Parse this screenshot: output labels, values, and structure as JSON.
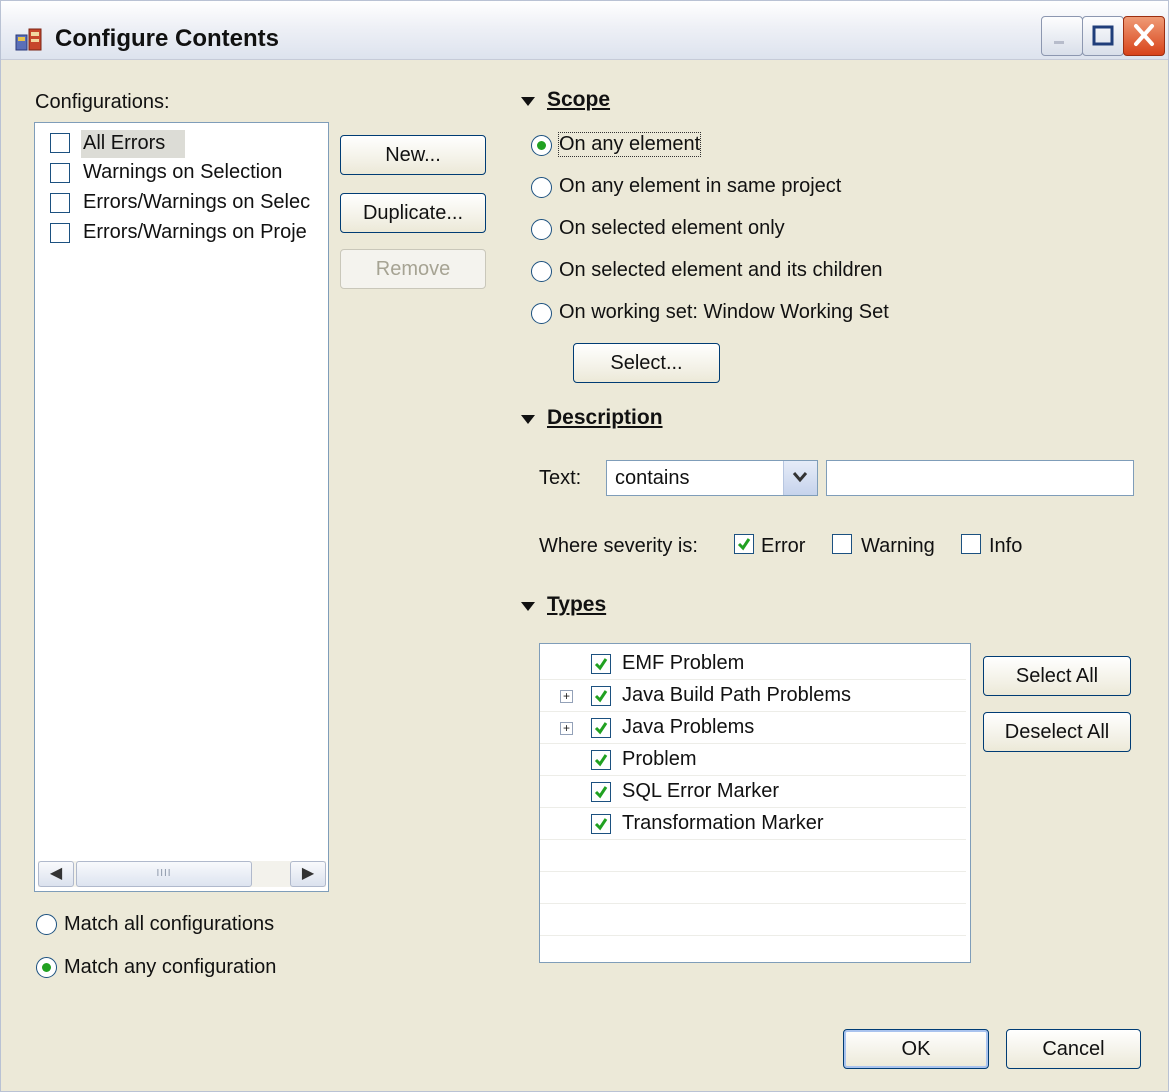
{
  "window": {
    "title": "Configure Contents",
    "accent": "#0a246a",
    "check_color": "#21a121",
    "close_color": "#d8431a"
  },
  "configurations": {
    "label": "Configurations:",
    "items": [
      {
        "label": "All Errors",
        "checked": false,
        "selected": true
      },
      {
        "label": "Warnings on Selection",
        "checked": false
      },
      {
        "label": "Errors/Warnings on Selec",
        "checked": false
      },
      {
        "label": "Errors/Warnings on Proje",
        "checked": false
      }
    ],
    "scroll_thumb_glyph": "IIII"
  },
  "buttons": {
    "new": "New...",
    "duplicate": "Duplicate...",
    "remove": "Remove",
    "select": "Select...",
    "select_all": "Select All",
    "deselect_all": "Deselect All",
    "ok": "OK",
    "cancel": "Cancel"
  },
  "match": {
    "all": "Match all configurations",
    "any": "Match any configuration",
    "selected": "any"
  },
  "scope": {
    "title": "Scope",
    "options": [
      {
        "label": "On any element",
        "selected": true
      },
      {
        "label": "On any element in same project",
        "selected": false
      },
      {
        "label": "On selected element only",
        "selected": false
      },
      {
        "label": "On selected element and its children",
        "selected": false
      },
      {
        "label": "On working set:  Window Working Set",
        "selected": false
      }
    ]
  },
  "description": {
    "title": "Description",
    "text_label": "Text:",
    "combo_value": "contains",
    "text_value": "",
    "severity_label": "Where severity is:",
    "severity": [
      {
        "label": "Error",
        "checked": true
      },
      {
        "label": "Warning",
        "checked": false
      },
      {
        "label": "Info",
        "checked": false
      }
    ]
  },
  "types": {
    "title": "Types",
    "items": [
      {
        "label": "EMF Problem",
        "checked": true,
        "expandable": false
      },
      {
        "label": "Java Build Path Problems",
        "checked": true,
        "expandable": true
      },
      {
        "label": "Java Problems",
        "checked": true,
        "expandable": true
      },
      {
        "label": "Problem",
        "checked": true,
        "expandable": false
      },
      {
        "label": "SQL Error Marker",
        "checked": true,
        "expandable": false
      },
      {
        "label": "Transformation Marker",
        "checked": true,
        "expandable": false
      }
    ]
  }
}
